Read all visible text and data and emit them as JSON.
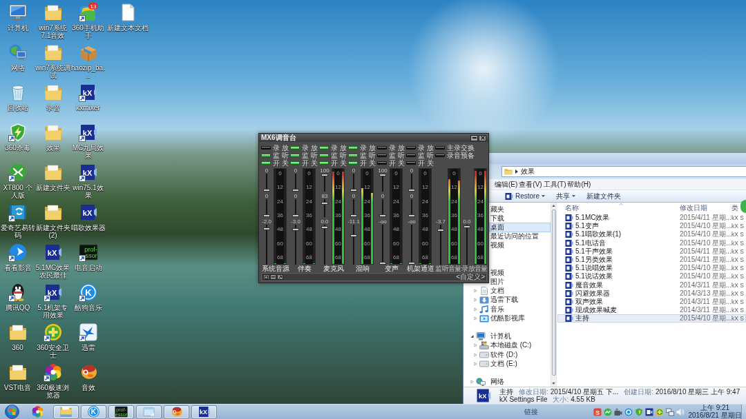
{
  "desktop_icons": [
    {
      "label": "计算机",
      "kind": "computer",
      "shortcut": false
    },
    {
      "label": "网络",
      "kind": "network",
      "shortcut": false
    },
    {
      "label": "回收站",
      "kind": "recycle",
      "shortcut": false
    },
    {
      "label": "360杀毒",
      "kind": "shield",
      "shortcut": true
    },
    {
      "label": "XT800 个人版",
      "kind": "remote",
      "shortcut": true
    },
    {
      "label": "爱奇艺易转码",
      "kind": "converter",
      "shortcut": true
    },
    {
      "label": "看看影音",
      "kind": "player",
      "shortcut": true
    },
    {
      "label": "腾讯QQ",
      "kind": "penguin",
      "shortcut": true
    },
    {
      "label": "360",
      "kind": "folder",
      "shortcut": false
    },
    {
      "label": "VST电音",
      "kind": "folder",
      "shortcut": false
    },
    {
      "label": "win7系统7.1音效",
      "kind": "folder",
      "shortcut": false
    },
    {
      "label": "win7系统调试",
      "kind": "folder",
      "shortcut": false
    },
    {
      "label": "录音",
      "kind": "folder",
      "shortcut": false
    },
    {
      "label": "效果",
      "kind": "folder",
      "shortcut": false
    },
    {
      "label": "新建文件夹",
      "kind": "folder",
      "shortcut": false
    },
    {
      "label": "新建文件夹 (2)",
      "kind": "folder",
      "shortcut": false
    },
    {
      "label": "5.1MC效果农民最佳",
      "kind": "kx",
      "logo": [
        "kX"
      ],
      "shortcut": false
    },
    {
      "label": "5.1机架专用效果",
      "kind": "kx",
      "logo": [
        "kX"
      ],
      "shortcut": true
    },
    {
      "label": "360安全卫士",
      "kind": "plus",
      "shortcut": true
    },
    {
      "label": "360极速浏览器",
      "kind": "pinwheel",
      "shortcut": true
    },
    {
      "label": "360手机助手",
      "kind": "apps",
      "badge": "13",
      "shortcut": true
    },
    {
      "label": "haozip_ba...",
      "kind": "package",
      "shortcut": false
    },
    {
      "label": "kxmixer",
      "kind": "kx",
      "logo": [
        "kX"
      ],
      "shortcut": true
    },
    {
      "label": "MC九局效果",
      "kind": "kx",
      "logo": [
        "kX"
      ],
      "shortcut": true
    },
    {
      "label": "win75.1效果",
      "kind": "kx",
      "logo": [
        "kX"
      ],
      "shortcut": true
    },
    {
      "label": "唱歌效果器",
      "kind": "kx",
      "logo": [
        "kX"
      ],
      "shortcut": false
    },
    {
      "label": "电音启动",
      "kind": "professor",
      "logo": [
        "prof-",
        "ssor"
      ],
      "shortcut": true
    },
    {
      "label": "酷狗音乐",
      "kind": "kugou",
      "logo": [
        "K"
      ],
      "shortcut": true
    },
    {
      "label": "迅雷",
      "kind": "bird",
      "shortcut": true
    },
    {
      "label": "音效",
      "kind": "mascot",
      "shortcut": false
    },
    {
      "label": "新建文本文档",
      "kind": "document",
      "shortcut": false
    }
  ],
  "mixer": {
    "title": "MX6调音台",
    "channels": [
      {
        "name": "系统音源",
        "switches": [
          {
            "label": "录 放",
            "on": false
          },
          {
            "label": "监 听",
            "on": true
          },
          {
            "label": "开 关",
            "on": true
          }
        ],
        "faders": [
          {
            "value": "0",
            "level": 0
          },
          {
            "value": "0",
            "level": 0
          },
          {
            "value": "-2.0",
            "level": 0.93
          }
        ],
        "meter": {
          "scale": [
            "0",
            "12",
            "24",
            "36",
            "48",
            "60",
            "68"
          ],
          "bars": [
            {
              "level": 0
            },
            {
              "level": 0
            }
          ]
        }
      },
      {
        "name": "伴奏",
        "switches": [
          {
            "label": "录 放",
            "on": true
          },
          {
            "label": "监 听",
            "on": true
          },
          {
            "label": "开 关",
            "on": true
          }
        ],
        "faders": [
          {
            "value": "0",
            "level": 0
          },
          {
            "value": "0",
            "level": 0
          },
          {
            "value": "-3.0",
            "level": 0.91
          }
        ],
        "meter": {
          "scale": [
            "0",
            "12",
            "24",
            "36",
            "48",
            "60",
            "68"
          ],
          "bars": [
            {
              "level": 0
            },
            {
              "level": 0
            }
          ]
        }
      },
      {
        "name": "麦克风",
        "switches": [
          {
            "label": "录 放",
            "on": true
          },
          {
            "label": "监 听",
            "on": true
          },
          {
            "label": "开 关",
            "on": true
          }
        ],
        "faders": [
          {
            "value": "100",
            "level": 1
          },
          {
            "value": "83",
            "level": 0.83
          },
          {
            "value": "0.0",
            "level": 0.97
          }
        ],
        "meter": {
          "scale": [
            "0",
            "12",
            "24",
            "36",
            "48",
            "60",
            "68"
          ],
          "bars": [
            {
              "level": 0.97
            },
            {
              "level": 0.97
            }
          ]
        }
      },
      {
        "name": "混响",
        "switches": [
          {
            "label": "录 放",
            "on": true
          },
          {
            "label": "监 听",
            "on": true
          },
          {
            "label": "开 关",
            "on": true
          }
        ],
        "faders": [
          {
            "value": "0",
            "level": 0
          },
          {
            "value": "0",
            "level": 0
          },
          {
            "value": "-11.1",
            "level": 0.75
          }
        ],
        "meter": {
          "scale": [
            "0",
            "12",
            "24",
            "36",
            "48",
            "60",
            "68"
          ],
          "bars": [
            {
              "level": 0.8
            },
            {
              "level": 0.75
            }
          ]
        }
      },
      {
        "name": "变声",
        "switches": [
          {
            "label": "录 放",
            "on": false
          },
          {
            "label": "监 听",
            "on": false
          },
          {
            "label": "开 关",
            "on": false
          }
        ],
        "faders": [
          {
            "value": "100",
            "level": 1
          },
          {
            "value": "0",
            "level": 0
          },
          {
            "value": "-oo",
            "level": 0
          }
        ],
        "meter": {
          "scale": [
            "0",
            "12",
            "24",
            "36",
            "48",
            "60",
            "68"
          ],
          "bars": [
            {
              "level": 0
            },
            {
              "level": 0
            }
          ]
        }
      },
      {
        "name": "机架通道",
        "switches": [
          {
            "label": "录 放",
            "on": false
          },
          {
            "label": "监 听",
            "on": false
          },
          {
            "label": "开 关",
            "on": false
          }
        ],
        "faders": [
          {
            "value": "0",
            "level": 0
          },
          {
            "value": "0",
            "level": 0
          },
          {
            "value": "-oo",
            "level": 0
          }
        ],
        "meter": {
          "scale": [
            "0",
            "12",
            "24",
            "36",
            "48",
            "60",
            "68"
          ],
          "bars": [
            {
              "level": 0
            },
            {
              "level": 0
            }
          ]
        }
      }
    ],
    "outputs": {
      "switches": [
        {
          "label": "主录交换",
          "on": false
        },
        {
          "label": "录音预备",
          "on": false
        }
      ],
      "channels": [
        {
          "name": "监听音量",
          "faders": [
            {
              "value": "-3.7",
              "level": 0.89
            }
          ],
          "meter": {
            "scale": [
              "0",
              "12",
              "24",
              "36",
              "48",
              "60",
              "68"
            ],
            "bars": [
              {
                "level": 0.89
              },
              {
                "level": 0.88
              }
            ]
          }
        },
        {
          "name": "录放音量",
          "faders": [
            {
              "value": "0.0",
              "level": 0.98
            }
          ],
          "meter": {
            "scale": [
              "0",
              "12",
              "24",
              "36",
              "48",
              "60",
              "68"
            ],
            "bars": [
              {
                "level": 0.98
              },
              {
                "level": 0.98
              }
            ]
          }
        }
      ]
    },
    "preset": "<自定义>"
  },
  "explorer": {
    "address": [
      "效果"
    ],
    "menu": [
      "编辑(E)",
      "查看(V)",
      "工具(T)",
      "帮助(H)"
    ],
    "toolbar": [
      {
        "label": "Restore",
        "kind": "app",
        "dropdown": true
      },
      {
        "label": "共享",
        "dropdown": true
      },
      {
        "label": "新建文件夹",
        "dropdown": false
      }
    ],
    "nav": [
      {
        "label": "藏夹",
        "selected": false,
        "children": [
          {
            "label": "下载",
            "selected": false
          },
          {
            "label": "桌面",
            "selected": true
          },
          {
            "label": "最近访问的位置",
            "selected": false
          },
          {
            "label": "视频",
            "selected": false
          }
        ]
      },
      {
        "children": [
          {
            "label": "视频",
            "selected": false
          },
          {
            "label": "图片",
            "selected": false
          },
          {
            "label": "文档",
            "kind": "documents",
            "expanded": false,
            "selected": false
          },
          {
            "label": "迅雷下载",
            "kind": "downloads",
            "expanded": false,
            "selected": false
          },
          {
            "label": "音乐",
            "kind": "music",
            "expanded": false,
            "selected": false
          },
          {
            "label": "优酷影视库",
            "kind": "video-library",
            "expanded": false,
            "selected": false
          }
        ]
      },
      {
        "label": "计算机",
        "kind": "computer",
        "expanded": true,
        "selected": false,
        "children": [
          {
            "label": "本地磁盘 (C:)",
            "kind": "system-drive",
            "expanded": false,
            "selected": false
          },
          {
            "label": "软件 (D:)",
            "kind": "drive",
            "expanded": false,
            "selected": false
          },
          {
            "label": "文档 (E:)",
            "kind": "drive",
            "expanded": false,
            "selected": false
          }
        ]
      },
      {
        "label": "网络",
        "kind": "network",
        "expanded": false,
        "selected": false
      }
    ],
    "columns": [
      "名称",
      "修改日期",
      "类"
    ],
    "files": [
      {
        "name": "5.1MC效果",
        "modified": "2015/4/11 星期...",
        "type": "kX S",
        "selected": false
      },
      {
        "name": "5.1变声",
        "modified": "2015/4/10 星期...",
        "type": "kX S",
        "selected": false
      },
      {
        "name": "5.1唱歌效果(1)",
        "modified": "2015/4/10 星期...",
        "type": "kX S",
        "selected": false
      },
      {
        "name": "5.1电话音",
        "modified": "2015/4/10 星期...",
        "type": "kX S",
        "selected": false
      },
      {
        "name": "5.1干声效果",
        "modified": "2015/4/11 星期...",
        "type": "kX S",
        "selected": false
      },
      {
        "name": "5.1另类效果",
        "modified": "2015/4/11 星期...",
        "type": "kX S",
        "selected": false
      },
      {
        "name": "5.1说唱效果",
        "modified": "2015/4/10 星期...",
        "type": "kX S",
        "selected": false
      },
      {
        "name": "5.1说话效果",
        "modified": "2015/4/10 星期...",
        "type": "kX S",
        "selected": false
      },
      {
        "name": "魔音效果",
        "modified": "2014/3/11 星期...",
        "type": "kX S",
        "selected": false
      },
      {
        "name": "闪避效果器",
        "modified": "2014/3/13 星期...",
        "type": "kX S",
        "selected": false
      },
      {
        "name": "双声效果",
        "modified": "2014/3/11 星期...",
        "type": "kX S",
        "selected": false
      },
      {
        "name": "现成效果喊麦",
        "modified": "2014/3/11 星期...",
        "type": "kX S",
        "selected": false
      },
      {
        "name": "主持",
        "modified": "2015/4/10 星期...",
        "type": "kX S",
        "selected": true
      }
    ],
    "details": {
      "logo": [
        "kX"
      ],
      "name": "主持",
      "type": "kX Settings File",
      "fields": [
        {
          "label": "修改日期:",
          "value": "2015/4/10 星期五 下..."
        },
        {
          "label": "创建日期:",
          "value": "2016/8/10 星期三 上午 9:47"
        },
        {
          "label": "大小:",
          "value": "4.55 KB"
        }
      ]
    }
  },
  "taskbar": {
    "buttons": [
      {
        "kind": "pinwheel",
        "running": false
      },
      {
        "kind": "explorer",
        "running": true
      },
      {
        "kind": "kugou",
        "logo": [
          "K"
        ],
        "running": true
      },
      {
        "kind": "professor",
        "logo": [
          "prof-",
          "essor"
        ],
        "running": true
      },
      {
        "kind": "notepad",
        "running": true
      },
      {
        "kind": "mascot",
        "running": true
      },
      {
        "kind": "kx",
        "logo": [
          "kX"
        ],
        "running": true
      }
    ],
    "links": "链接",
    "tray": [
      {
        "kind": "sogou",
        "logo": [
          "S"
        ]
      },
      {
        "kind": "ball"
      },
      {
        "kind": "camera"
      },
      {
        "kind": "ring"
      },
      {
        "kind": "shield"
      },
      {
        "kind": "tile"
      },
      {
        "kind": "plus"
      },
      {
        "kind": "network"
      },
      {
        "kind": "volume"
      }
    ],
    "clock": {
      "time": "上午 9:21",
      "date": "2016/8/21 星期日"
    }
  }
}
